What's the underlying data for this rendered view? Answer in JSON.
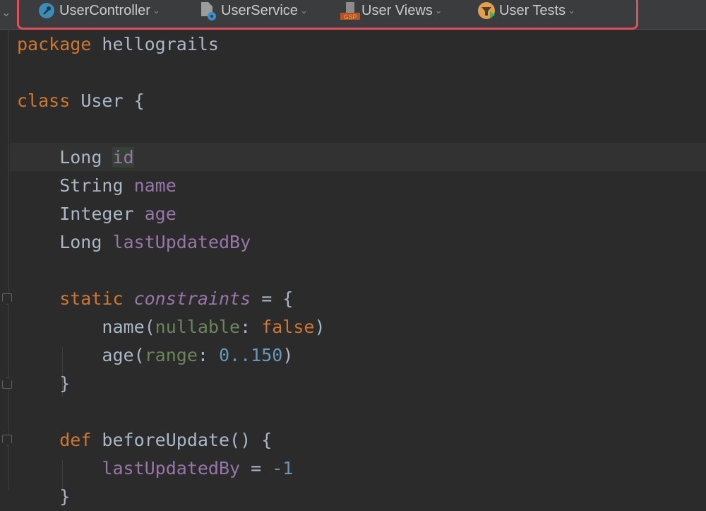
{
  "nav_bar": {
    "items": [
      {
        "label": "UserController",
        "icon": "wrench-icon"
      },
      {
        "label": "UserService",
        "icon": "service-gear-icon"
      },
      {
        "label": "User Views",
        "icon": "gsp-file-icon",
        "badge": "GSP"
      },
      {
        "label": "User Tests",
        "icon": "test-icon"
      }
    ],
    "highlight_color": "#e0505a"
  },
  "editor": {
    "lines": [
      [
        [
          "kw",
          "package"
        ],
        [
          "plain",
          " hellograils"
        ]
      ],
      [],
      [
        [
          "kw",
          "class"
        ],
        [
          "plain",
          " User {"
        ]
      ],
      [],
      [
        [
          "plain",
          "    Long "
        ],
        [
          "fld hl",
          "id"
        ]
      ],
      [
        [
          "plain",
          "    String "
        ],
        [
          "fld",
          "name"
        ]
      ],
      [
        [
          "plain",
          "    Integer "
        ],
        [
          "fld",
          "age"
        ]
      ],
      [
        [
          "plain",
          "    Long "
        ],
        [
          "fld",
          "lastUpdatedBy"
        ]
      ],
      [],
      [
        [
          "kw",
          "    static "
        ],
        [
          "ital",
          "constraints"
        ],
        [
          "plain",
          " = {"
        ]
      ],
      [
        [
          "plain",
          "        name("
        ],
        [
          "lbl",
          "nullable"
        ],
        [
          "plain",
          ": "
        ],
        [
          "kw",
          "false"
        ],
        [
          "plain",
          ")"
        ]
      ],
      [
        [
          "plain",
          "        age("
        ],
        [
          "lbl",
          "range"
        ],
        [
          "plain",
          ": "
        ],
        [
          "num",
          "0..150"
        ],
        [
          "plain",
          ")"
        ]
      ],
      [
        [
          "plain",
          "    }"
        ]
      ],
      [],
      [
        [
          "kw",
          "    def "
        ],
        [
          "plain",
          "beforeUpdate() {"
        ]
      ],
      [
        [
          "fld",
          "        lastUpdatedBy"
        ],
        [
          "plain",
          " = "
        ],
        [
          "num",
          "-1"
        ]
      ],
      [
        [
          "plain",
          "    }"
        ]
      ]
    ]
  }
}
